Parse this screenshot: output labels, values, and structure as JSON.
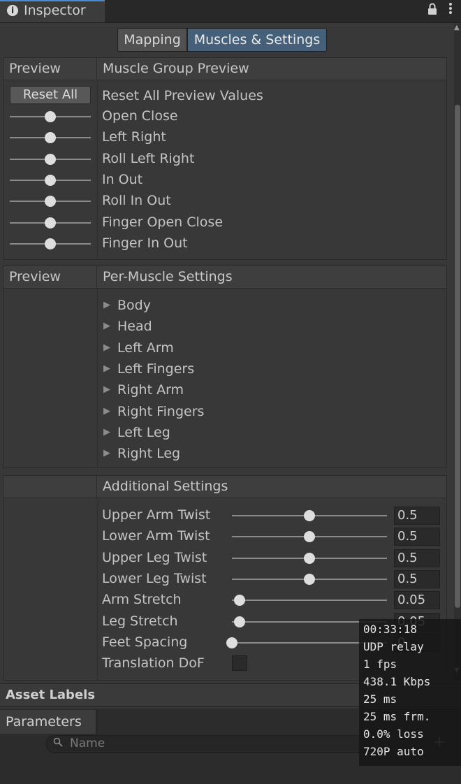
{
  "window": {
    "tab_title": "Inspector",
    "tab_icon": "info-icon"
  },
  "toggle": {
    "mapping": "Mapping",
    "muscles": "Muscles & Settings",
    "selected": "Muscles & Settings"
  },
  "muscle_group": {
    "left_header": "Preview",
    "right_header": "Muscle Group Preview",
    "reset_button": "Reset All",
    "reset_label": "Reset All Preview Values",
    "rows": [
      {
        "label": "Open Close",
        "value": 0.5
      },
      {
        "label": "Left Right",
        "value": 0.5
      },
      {
        "label": "Roll Left Right",
        "value": 0.5
      },
      {
        "label": "In Out",
        "value": 0.5
      },
      {
        "label": "Roll In Out",
        "value": 0.5
      },
      {
        "label": "Finger Open Close",
        "value": 0.5
      },
      {
        "label": "Finger In Out",
        "value": 0.5
      }
    ]
  },
  "per_muscle": {
    "left_header": "Preview",
    "right_header": "Per-Muscle Settings",
    "items": [
      "Body",
      "Head",
      "Left Arm",
      "Left Fingers",
      "Right Arm",
      "Right Fingers",
      "Left Leg",
      "Right Leg"
    ]
  },
  "additional": {
    "header": "Additional Settings",
    "rows": [
      {
        "label": "Upper Arm Twist",
        "value": "0.5",
        "level": 0.5
      },
      {
        "label": "Lower Arm Twist",
        "value": "0.5",
        "level": 0.5
      },
      {
        "label": "Upper Leg Twist",
        "value": "0.5",
        "level": 0.5
      },
      {
        "label": "Lower Leg Twist",
        "value": "0.5",
        "level": 0.5
      },
      {
        "label": "Arm Stretch",
        "value": "0.05",
        "level": 0.05
      },
      {
        "label": "Leg Stretch",
        "value": "0.05",
        "level": 0.05
      },
      {
        "label": "Feet Spacing",
        "value": "0",
        "level": 0
      }
    ],
    "translation_dof_label": "Translation DoF",
    "translation_dof_checked": false
  },
  "asset_labels": "Asset Labels",
  "parameters": {
    "tab": "Parameters",
    "search_placeholder": "Name",
    "add_symbol": "+"
  },
  "stats_overlay": [
    "00:33:18",
    "UDP relay",
    "1 fps",
    "438.1 Kbps",
    "25 ms",
    "25 ms frm.",
    "0.0% loss",
    "720P auto"
  ],
  "colors": {
    "background": "#383838",
    "accent": "#46607a",
    "tab_underline": "#4a8ad4"
  }
}
